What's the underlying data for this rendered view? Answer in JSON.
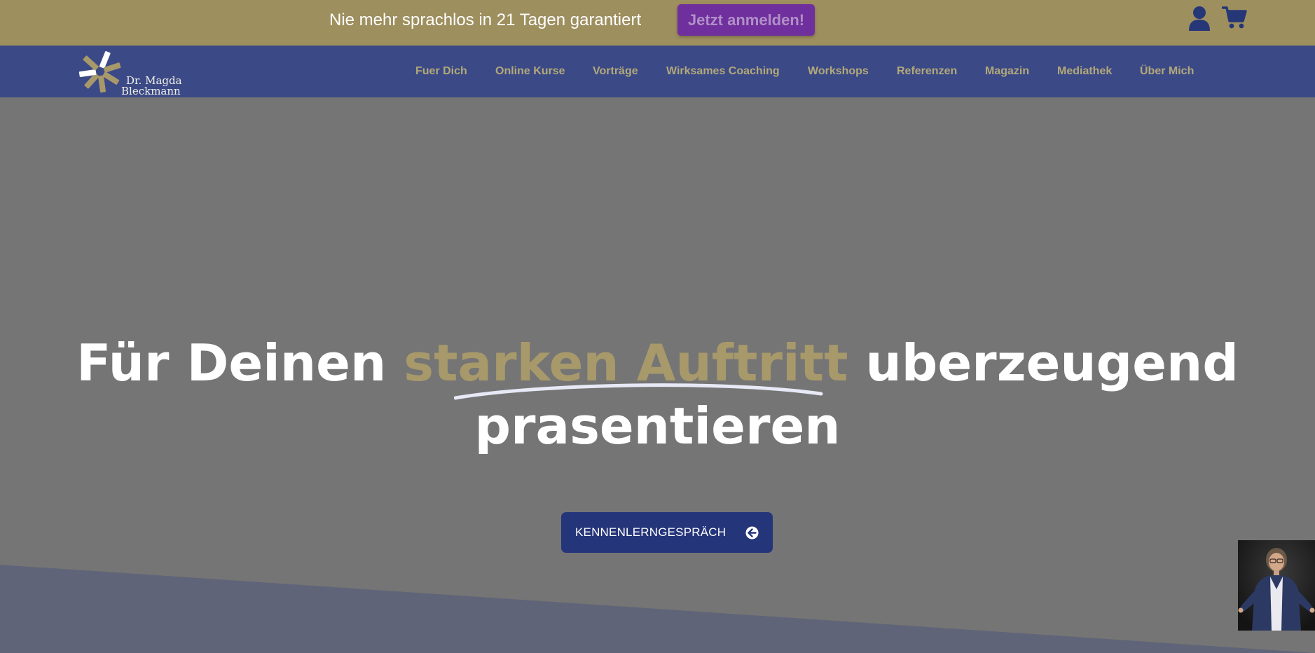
{
  "banner": {
    "text": "Nie mehr sprachlos in 21 Tagen garantiert",
    "cta_label": "Jetzt anmelden!",
    "icons": [
      "user-icon",
      "cart-icon"
    ],
    "background_color": "#9e8f5f",
    "cta_color": "#6f2f9c"
  },
  "logo": {
    "line1": "Dr. Magda",
    "line2": "Bleckmann"
  },
  "nav": {
    "background_color": "#3b4a86",
    "items": [
      {
        "label": "Fuer Dich"
      },
      {
        "label": "Online Kurse"
      },
      {
        "label": "Vorträge"
      },
      {
        "label": "Wirksames Coaching"
      },
      {
        "label": "Workshops"
      },
      {
        "label": "Referenzen"
      },
      {
        "label": "Magazin"
      },
      {
        "label": "Mediathek"
      },
      {
        "label": "Über Mich"
      }
    ]
  },
  "hero": {
    "heading_part1": "Für Deinen ",
    "heading_highlight": "starken Auftritt",
    "heading_part2": " uberzeugend",
    "heading_line2": "prasentieren",
    "highlight_color": "#a8996b",
    "cta_label": "KENNENLERNGESPRÄCH",
    "cta_icon": "arrow-circle-left-icon",
    "cta_color": "#25357a"
  },
  "video": {
    "icon": "video-thumbnail"
  }
}
